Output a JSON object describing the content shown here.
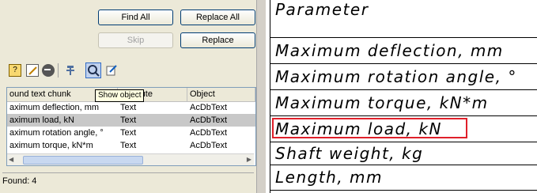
{
  "dialog": {
    "buttons": {
      "find_all": "Find All",
      "replace_all": "Replace All",
      "skip": "Skip",
      "replace": "Replace"
    },
    "tooltip": "Show object",
    "grid": {
      "columns": [
        "ound text chunk",
        "Attribute",
        "Object"
      ],
      "column_sort_icon": "chevron-down-icon",
      "rows": [
        {
          "chunk": "aximum deflection, mm",
          "attribute": "Text",
          "object": "AcDbText"
        },
        {
          "chunk": "aximum load, kN",
          "attribute": "Text",
          "object": "AcDbText"
        },
        {
          "chunk": "aximum rotation angle, °",
          "attribute": "Text",
          "object": "AcDbText"
        },
        {
          "chunk": "aximum torque, kN*m",
          "attribute": "Text",
          "object": "AcDbText"
        }
      ],
      "selected_row": 1
    },
    "status": "Found: 4",
    "toolbar_icons": [
      "properties-icon",
      "edit-icon",
      "remove-icon",
      "pin-icon",
      "zoom-icon",
      "export-icon"
    ]
  },
  "drawing": {
    "rows": [
      "Parameter",
      "Maximum deflection, mm",
      "Maximum rotation angle, °",
      "Maximum torque, kN*m",
      "Maximum load, kN",
      "Shaft weight, kg",
      "Length, mm"
    ],
    "highlighted_row": 4,
    "highlight_color": "#e0202a"
  }
}
